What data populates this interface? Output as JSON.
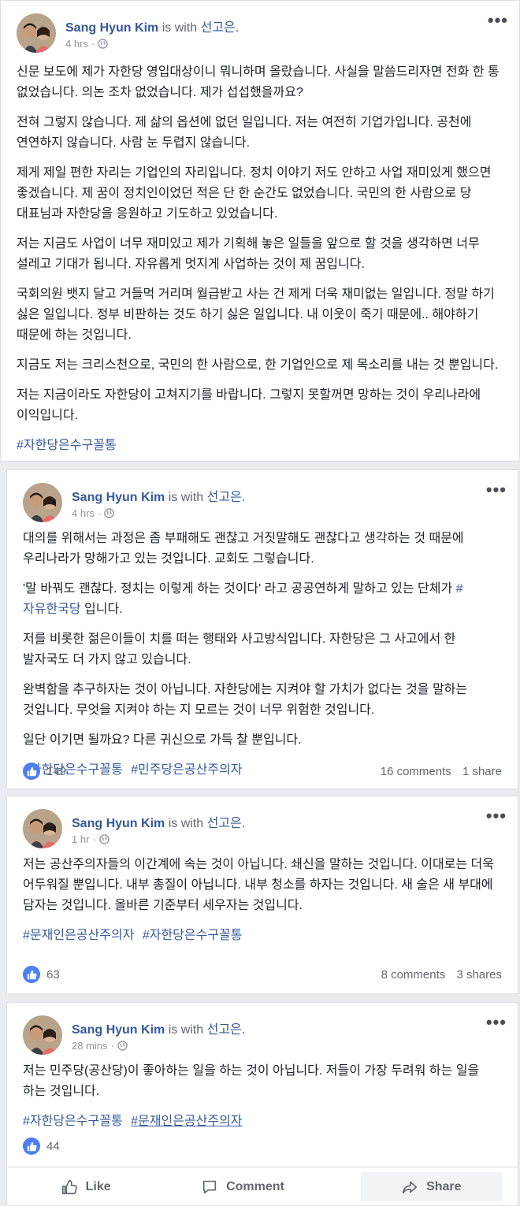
{
  "posts": [
    {
      "author": "Sang Hyun Kim",
      "with_text": "is with",
      "tagged": "선고은.",
      "time": "4 hrs",
      "paragraphs": [
        "신문 보도에 제가 자한당 영입대상이니 뭐니하며 올랐습니다. 사실을 말씀드리자면 전화 한 통 없었습니다. 의논 조차 없었습니다. 제가 섭섭했을까요?",
        "전혀 그렇지 않습니다. 제 삶의 옵션에 없던 일입니다. 저는 여전히 기업가입니다. 공천에 연연하지 않습니다. 사람 눈 두렵지 않습니다.",
        "제게 제일 편한 자리는 기업인의 자리입니다. 정치 이야기 저도 안하고 사업 재미있게 했으면 좋겠습니다. 제 꿈이 정치인이었던 적은 단 한 순간도 없었습니다. 국민의 한 사람으로 당 대표님과 자한당을 응원하고 기도하고 있었습니다.",
        "저는 지금도 사업이 너무 재미있고 제가 기획해 놓은 일들을 앞으로 할 것을 생각하면 너무 설레고 기대가 됩니다. 자유롭게 멋지게 사업하는 것이 제 꿈입니다.",
        "국회의원 뱃지 달고 거들먹 거리며 월급받고 사는 건 제게 더욱 재미없는 일입니다. 정말 하기 싫은 일입니다. 정부 비판하는 것도 하기 싫은 일입니다. 내 이웃이 죽기 때문에.. 해야하기 때문에 하는 것입니다.",
        "지금도 저는 크리스천으로, 국민의 한 사람으로, 한 기업인으로 제 목소리를 내는 것 뿐입니다.",
        "저는 지금이라도 자한당이 고쳐지기를 바랍니다. 그렇지 못할꺼면 망하는 것이 우리나라에 이익입니다."
      ],
      "hashtags": [
        "#자한당은수구꼴통"
      ]
    },
    {
      "author": "Sang Hyun Kim",
      "with_text": "is with",
      "tagged": "선고은.",
      "time": "4 hrs",
      "paragraphs": [
        "대의를 위해서는 과정은 좀 부패해도 괜찮고 거짓말해도 괜찮다고 생각하는 것 때문에 우리나라가 망해가고 있는 것입니다. 교회도 그렇습니다.",
        "저를 비롯한 젊은이들이 치를 떠는 행태와 사고방식입니다. 자한당은 그 사고에서 한 발자국도 더 가지 않고 있습니다.",
        "완벽함을 추구하자는 것이 아닙니다. 자한당에는 지켜야 할 가치가 없다는 것을 말하는 것입니다. 무엇을 지켜야 하는 지 모르는 것이 너무 위험한 것입니다.",
        "일단 이기면 될까요? 다른 귀신으로 가득 찰 뿐입니다."
      ],
      "quote_pre": "'말 바꿔도 괜찮다. 정치는 이렇게 하는 것이다' 라고 공공연하게 말하고 있는 단체가 ",
      "quote_tag": "#자유한국당",
      "quote_post": " 입니다.",
      "hashtags": [
        "#자한당은수구꼴통",
        "#민주당은공산주의자"
      ],
      "likes": "149",
      "comments": "16 comments",
      "shares": "1 share"
    },
    {
      "author": "Sang Hyun Kim",
      "with_text": "is with",
      "tagged": "선고은.",
      "time": "1 hr",
      "paragraphs": [
        "저는 공산주의자들의 이간계에 속는 것이 아닙니다. 쇄신을 말하는 것입니다. 이대로는 더욱 어두워질 뿐입니다. 내부 총질이 아닙니다. 내부 청소를 하자는 것입니다. 새 술은 새 부대에 담자는 것입니다. 올바른 기준부터 세우자는 것입니다."
      ],
      "hashtags": [
        "#문재인은공산주의자",
        "#자한당은수구꼴통"
      ],
      "likes": "63",
      "comments": "8 comments",
      "shares": "3 shares"
    },
    {
      "author": "Sang Hyun Kim",
      "with_text": "is with",
      "tagged": "선고은.",
      "time": "28 mins",
      "paragraphs": [
        "저는 민주당(공산당)이 좋아하는 일을 하는 것이 아닙니다. 저들이 가장 두려워 하는 일을 하는 것입니다."
      ],
      "hashtags": [
        "#자한당은수구꼴통",
        "#문재인은공산주의자"
      ],
      "likes": "44",
      "actions": {
        "like": "Like",
        "comment": "Comment",
        "share": "Share"
      }
    }
  ],
  "icons": {
    "avatar": "avatar-photo",
    "privacy": "globe-icon",
    "menu": "more-options-icon",
    "reaction": "thumbs-up-icon"
  },
  "colors": {
    "link": "#365899",
    "like": "#4d7ef3",
    "meta": "#90949c"
  }
}
